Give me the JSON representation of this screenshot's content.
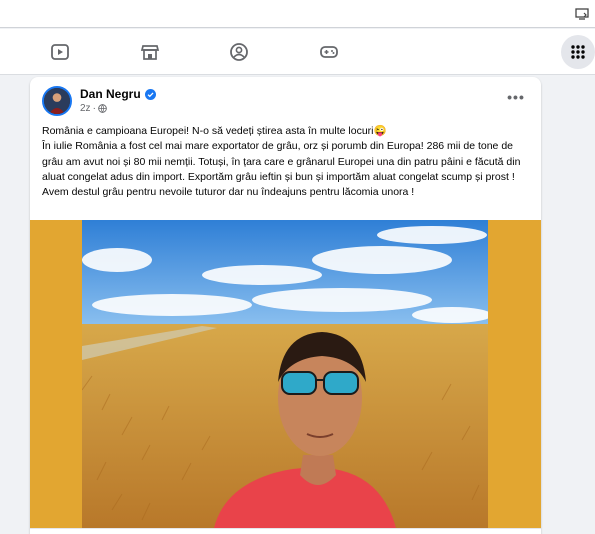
{
  "browser": {
    "cast_icon": "cast-icon"
  },
  "navbar": {
    "tabs": [
      {
        "name": "video-icon"
      },
      {
        "name": "marketplace-icon"
      },
      {
        "name": "groups-icon"
      },
      {
        "name": "gaming-icon"
      }
    ],
    "menu_icon": "apps-grid-icon"
  },
  "post": {
    "author": "Dan Negru",
    "verified": true,
    "time": "2z",
    "privacy_icon": "globe-icon",
    "more_label": "•••",
    "text": [
      "România e campioana Europei! N-o să vedeți știrea asta în multe locuri😜",
      "În iulie România a fost cel mai mare exportator de grâu, orz și porumb din Europa! 286 mii de tone de grâu am avut noi și 80 mii nemții. Totuși, în țara care e grânarul Europei una din patru pâini e făcută din aluat congelat adus din import. Exportăm grâu ieftin și bun și importăm aluat congelat scump și prost ! Avem destul grâu pentru nevoile tuturor dar nu îndeajuns pentru lăcomia unora !"
    ],
    "media": {
      "background": "#e2a631",
      "description_icon": "wheat-field-selfie-photo"
    }
  },
  "colors": {
    "accent": "#1877f2",
    "page_bg": "#f0f2f5",
    "media_bg": "#e2a631"
  }
}
